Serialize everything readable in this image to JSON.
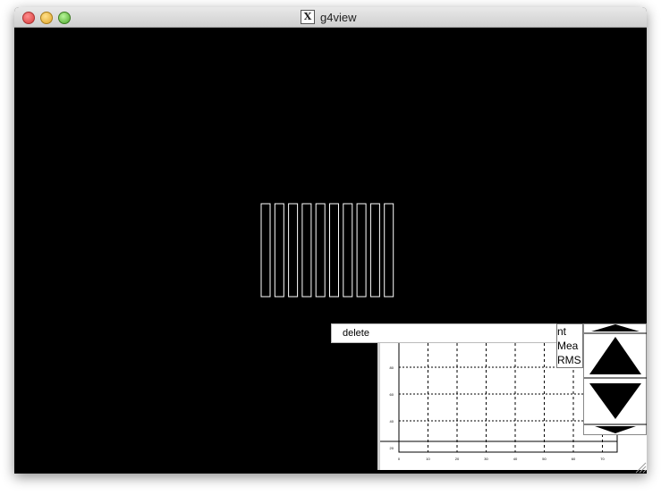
{
  "window": {
    "title": "g4view"
  },
  "icons": {
    "close": "close-button",
    "minimize": "minimize-button",
    "zoom": "zoom-button",
    "app": "x11-icon"
  },
  "context_menu": {
    "items": [
      "delete"
    ]
  },
  "histogram": {
    "stats_labels": [
      "nt",
      "Mea",
      "RMS"
    ],
    "y_ticks": [
      "80",
      "60",
      "40",
      "20"
    ],
    "x_ticks": [
      "0",
      "10",
      "20",
      "30",
      "40",
      "50",
      "60",
      "70"
    ]
  }
}
